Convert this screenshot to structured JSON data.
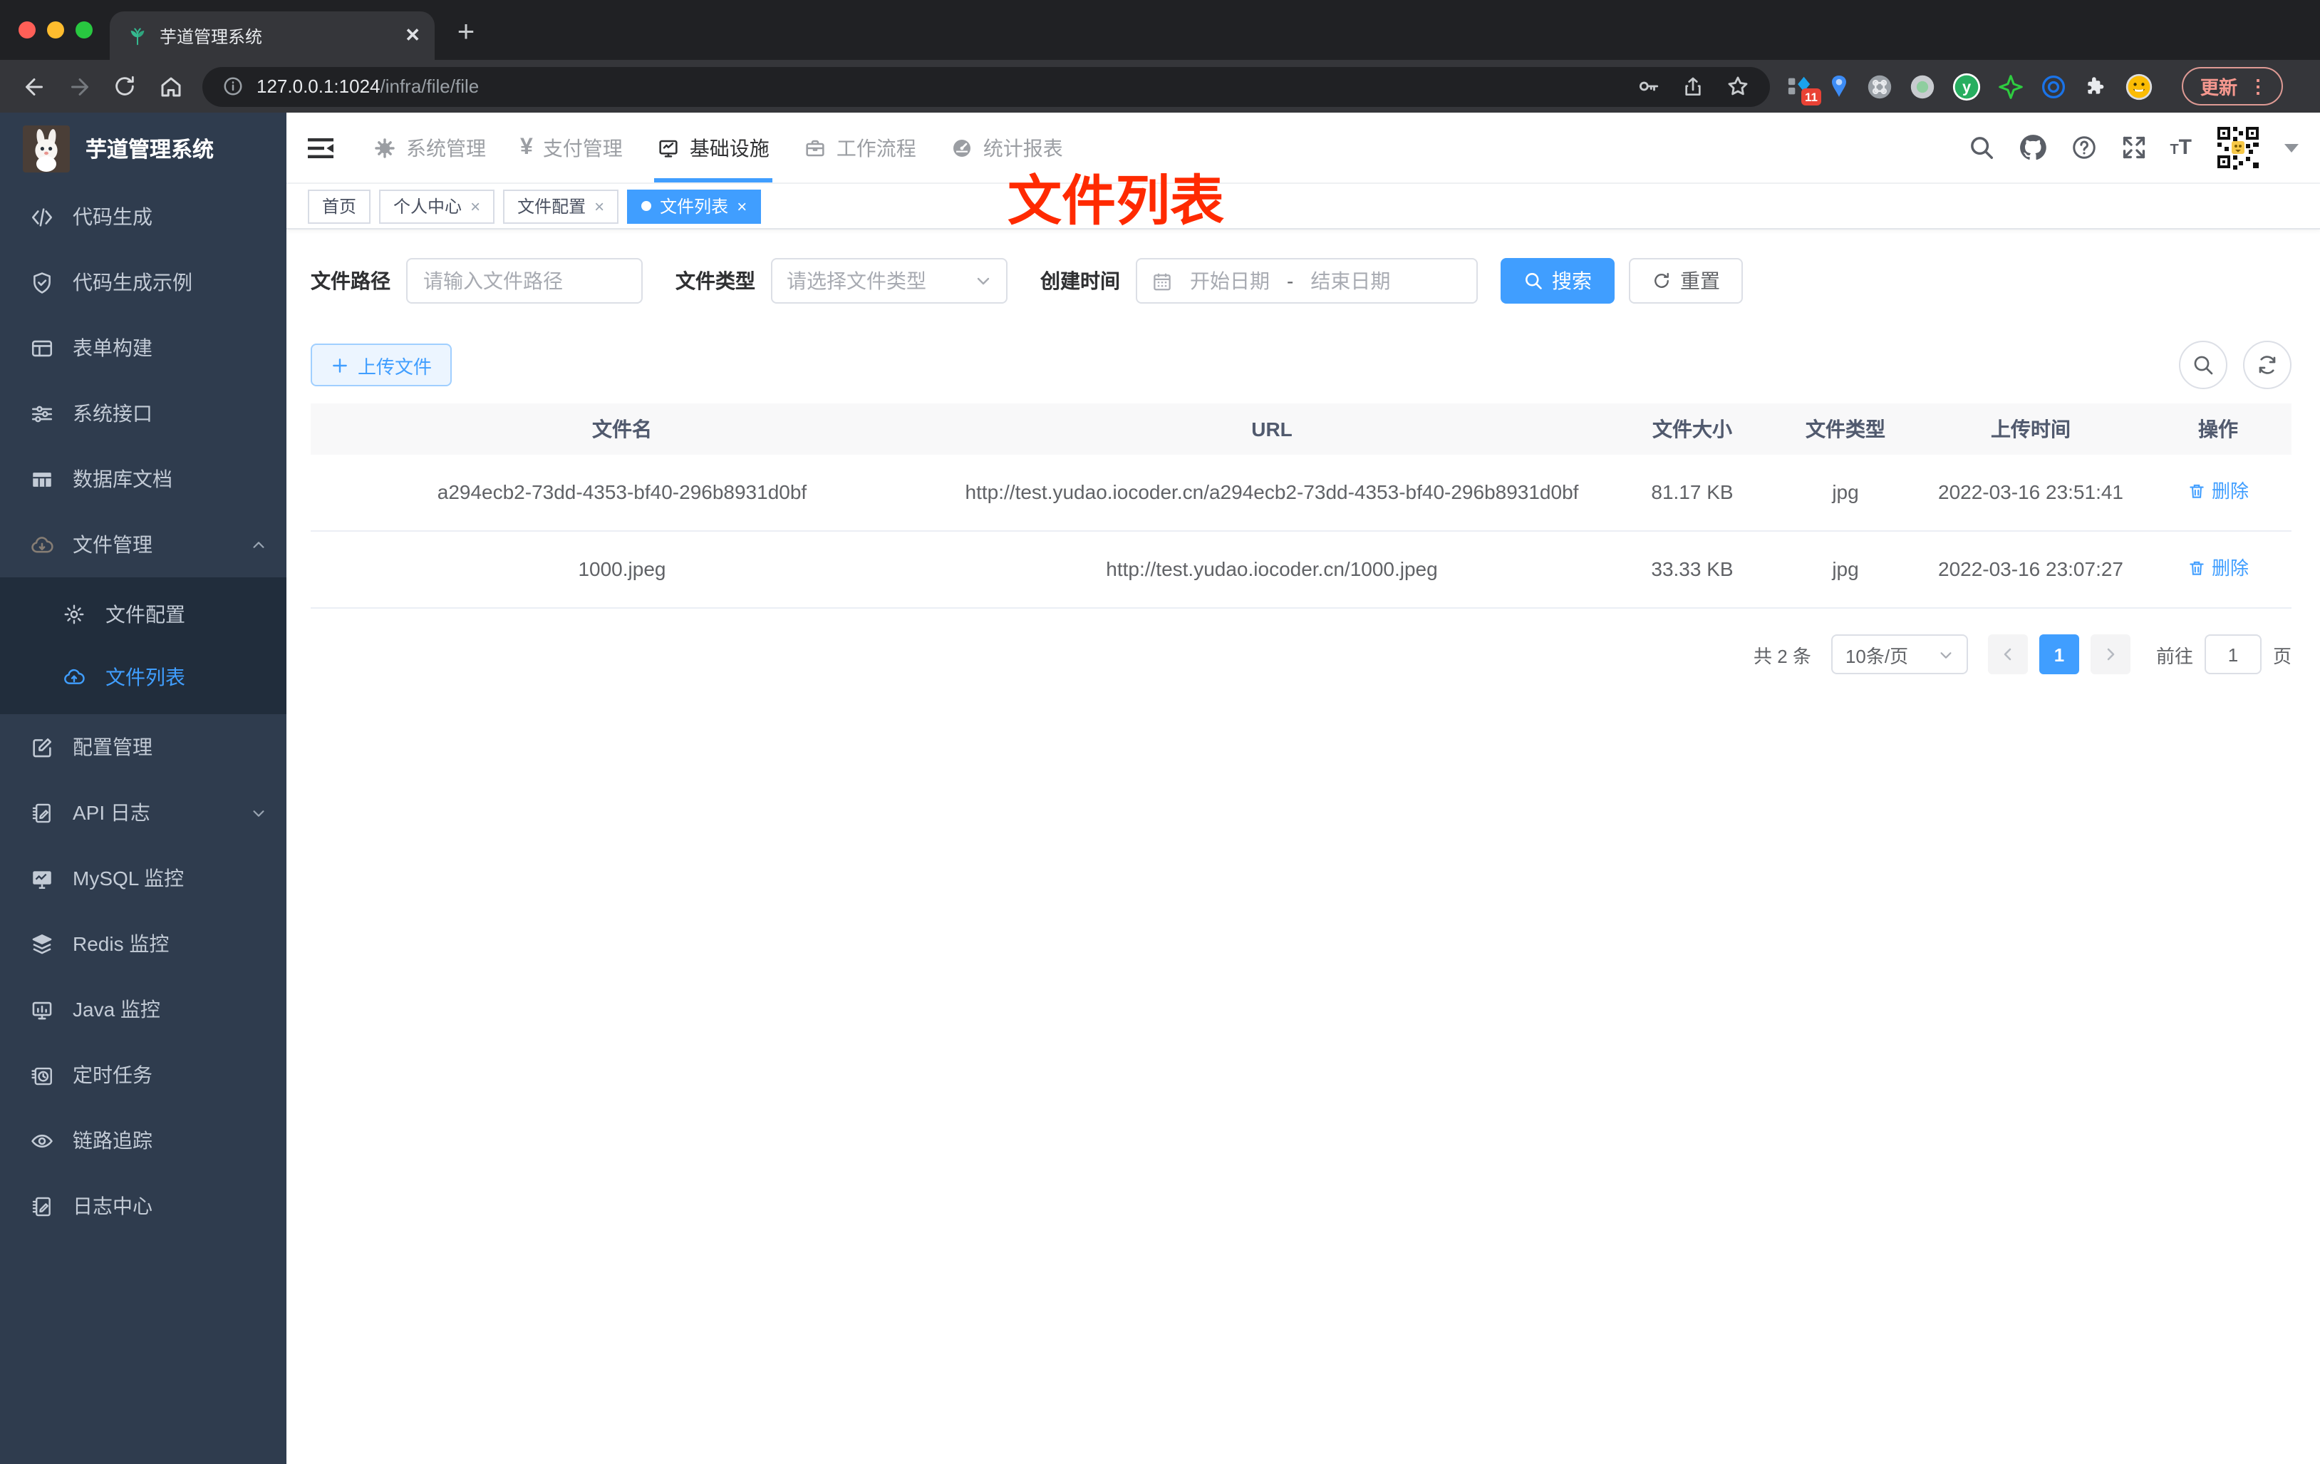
{
  "browser": {
    "tab_title": "芋道管理系统",
    "new_tab": "+",
    "url_host": "127.0.0.1:1024",
    "url_path": "/infra/file/file",
    "extension_badge": "11",
    "update_label": "更新"
  },
  "sidebar": {
    "title": "芋道管理系统",
    "items_top": [
      {
        "label": "代码生成",
        "icon": "code-icon"
      },
      {
        "label": "代码生成示例",
        "icon": "shield-check-icon"
      },
      {
        "label": "表单构建",
        "icon": "form-icon"
      },
      {
        "label": "系统接口",
        "icon": "sliders-icon"
      },
      {
        "label": "数据库文档",
        "icon": "table-icon"
      }
    ],
    "file_group": {
      "label": "文件管理",
      "icon": "cloud-download-icon",
      "expanded": true,
      "children": [
        {
          "label": "文件配置",
          "icon": "gear-icon",
          "active": false
        },
        {
          "label": "文件列表",
          "icon": "cloud-upload-icon",
          "active": true
        }
      ]
    },
    "items_bottom": [
      {
        "label": "配置管理",
        "icon": "edit-square-icon"
      },
      {
        "label": "API 日志",
        "icon": "log-icon",
        "has_arrow": true
      },
      {
        "label": "MySQL 监控",
        "icon": "monitor-chart-icon"
      },
      {
        "label": "Redis 监控",
        "icon": "layers-icon"
      },
      {
        "label": "Java 监控",
        "icon": "monitor-icon"
      },
      {
        "label": "定时任务",
        "icon": "timer-icon"
      },
      {
        "label": "链路追踪",
        "icon": "eye-icon"
      },
      {
        "label": "日志中心",
        "icon": "log-icon"
      }
    ]
  },
  "topnav": {
    "items": [
      {
        "label": "系统管理",
        "icon": "gear-icon",
        "active": false
      },
      {
        "label": "支付管理",
        "icon": "yen-icon",
        "active": false
      },
      {
        "label": "基础设施",
        "icon": "infra-monitor-icon",
        "active": true
      },
      {
        "label": "工作流程",
        "icon": "briefcase-icon",
        "active": false
      },
      {
        "label": "统计报表",
        "icon": "report-icon",
        "active": false
      }
    ]
  },
  "tags": [
    {
      "label": "首页",
      "closable": false,
      "active": false
    },
    {
      "label": "个人中心",
      "closable": true,
      "active": false
    },
    {
      "label": "文件配置",
      "closable": true,
      "active": false
    },
    {
      "label": "文件列表",
      "closable": true,
      "active": true
    }
  ],
  "annotation": {
    "text": "文件列表"
  },
  "filters": {
    "path_label": "文件路径",
    "path_placeholder": "请输入文件路径",
    "type_label": "文件类型",
    "type_placeholder": "请选择文件类型",
    "time_label": "创建时间",
    "start_placeholder": "开始日期",
    "range_separator": "-",
    "end_placeholder": "结束日期",
    "search_label": "搜索",
    "reset_label": "重置"
  },
  "toolbar": {
    "upload_label": "上传文件"
  },
  "table": {
    "columns": [
      "文件名",
      "URL",
      "文件大小",
      "文件类型",
      "上传时间",
      "操作"
    ],
    "rows": [
      {
        "name": "a294ecb2-73dd-4353-bf40-296b8931d0bf",
        "url": "http://test.yudao.iocoder.cn/a294ecb2-73dd-4353-bf40-296b8931d0bf",
        "size": "81.17 KB",
        "type": "jpg",
        "time": "2022-03-16 23:51:41",
        "action": "删除"
      },
      {
        "name": "1000.jpeg",
        "url": "http://test.yudao.iocoder.cn/1000.jpeg",
        "size": "33.33 KB",
        "type": "jpg",
        "time": "2022-03-16 23:07:27",
        "action": "删除"
      }
    ]
  },
  "pagination": {
    "total": "共 2 条",
    "page_size": "10条/页",
    "current_page": "1",
    "goto_label": "前往",
    "goto_value": "1",
    "goto_unit": "页"
  },
  "colors": {
    "accent": "#409eff",
    "annotation_red": "#ff2a00",
    "sidebar_bg": "#2f3c4e",
    "submenu_bg": "#212d3c"
  }
}
